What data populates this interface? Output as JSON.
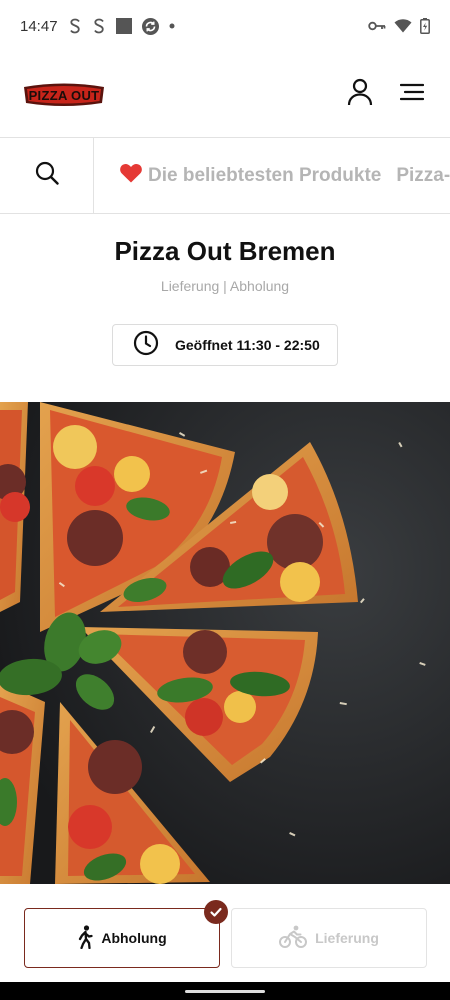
{
  "status_bar": {
    "time": "14:47",
    "left_icons": [
      "notification-s-icon",
      "notification-s-icon",
      "square-app-icon",
      "sync-app-icon",
      "dot-icon"
    ],
    "right_icons": [
      "vpn-key-icon",
      "wifi-icon",
      "battery-charging-icon"
    ]
  },
  "header": {
    "logo_text": "PIZZA OUT",
    "account_icon": "person-icon",
    "menu_icon": "hamburger-menu-icon"
  },
  "category_bar": {
    "search_icon": "search-icon",
    "items": [
      {
        "label": "Die beliebtesten Produkte",
        "icon": "heart-icon"
      },
      {
        "label": "Pizza-A"
      }
    ]
  },
  "store": {
    "name": "Pizza Out Bremen",
    "services": "Lieferung | Abholung",
    "hours_label": "Geöffnet 11:30 - 22:50",
    "hours_icon": "clock-icon"
  },
  "hero": {
    "image": "pizza-slices-photo"
  },
  "order_mode": {
    "pickup_label": "Abholung",
    "pickup_icon": "walking-person-icon",
    "pickup_selected": true,
    "delivery_label": "Lieferung",
    "delivery_icon": "bicycle-rider-icon",
    "delivery_selected": false
  },
  "colors": {
    "accent": "#7a2a1e",
    "heart": "#e53935",
    "muted_text": "#b5b5b5"
  }
}
